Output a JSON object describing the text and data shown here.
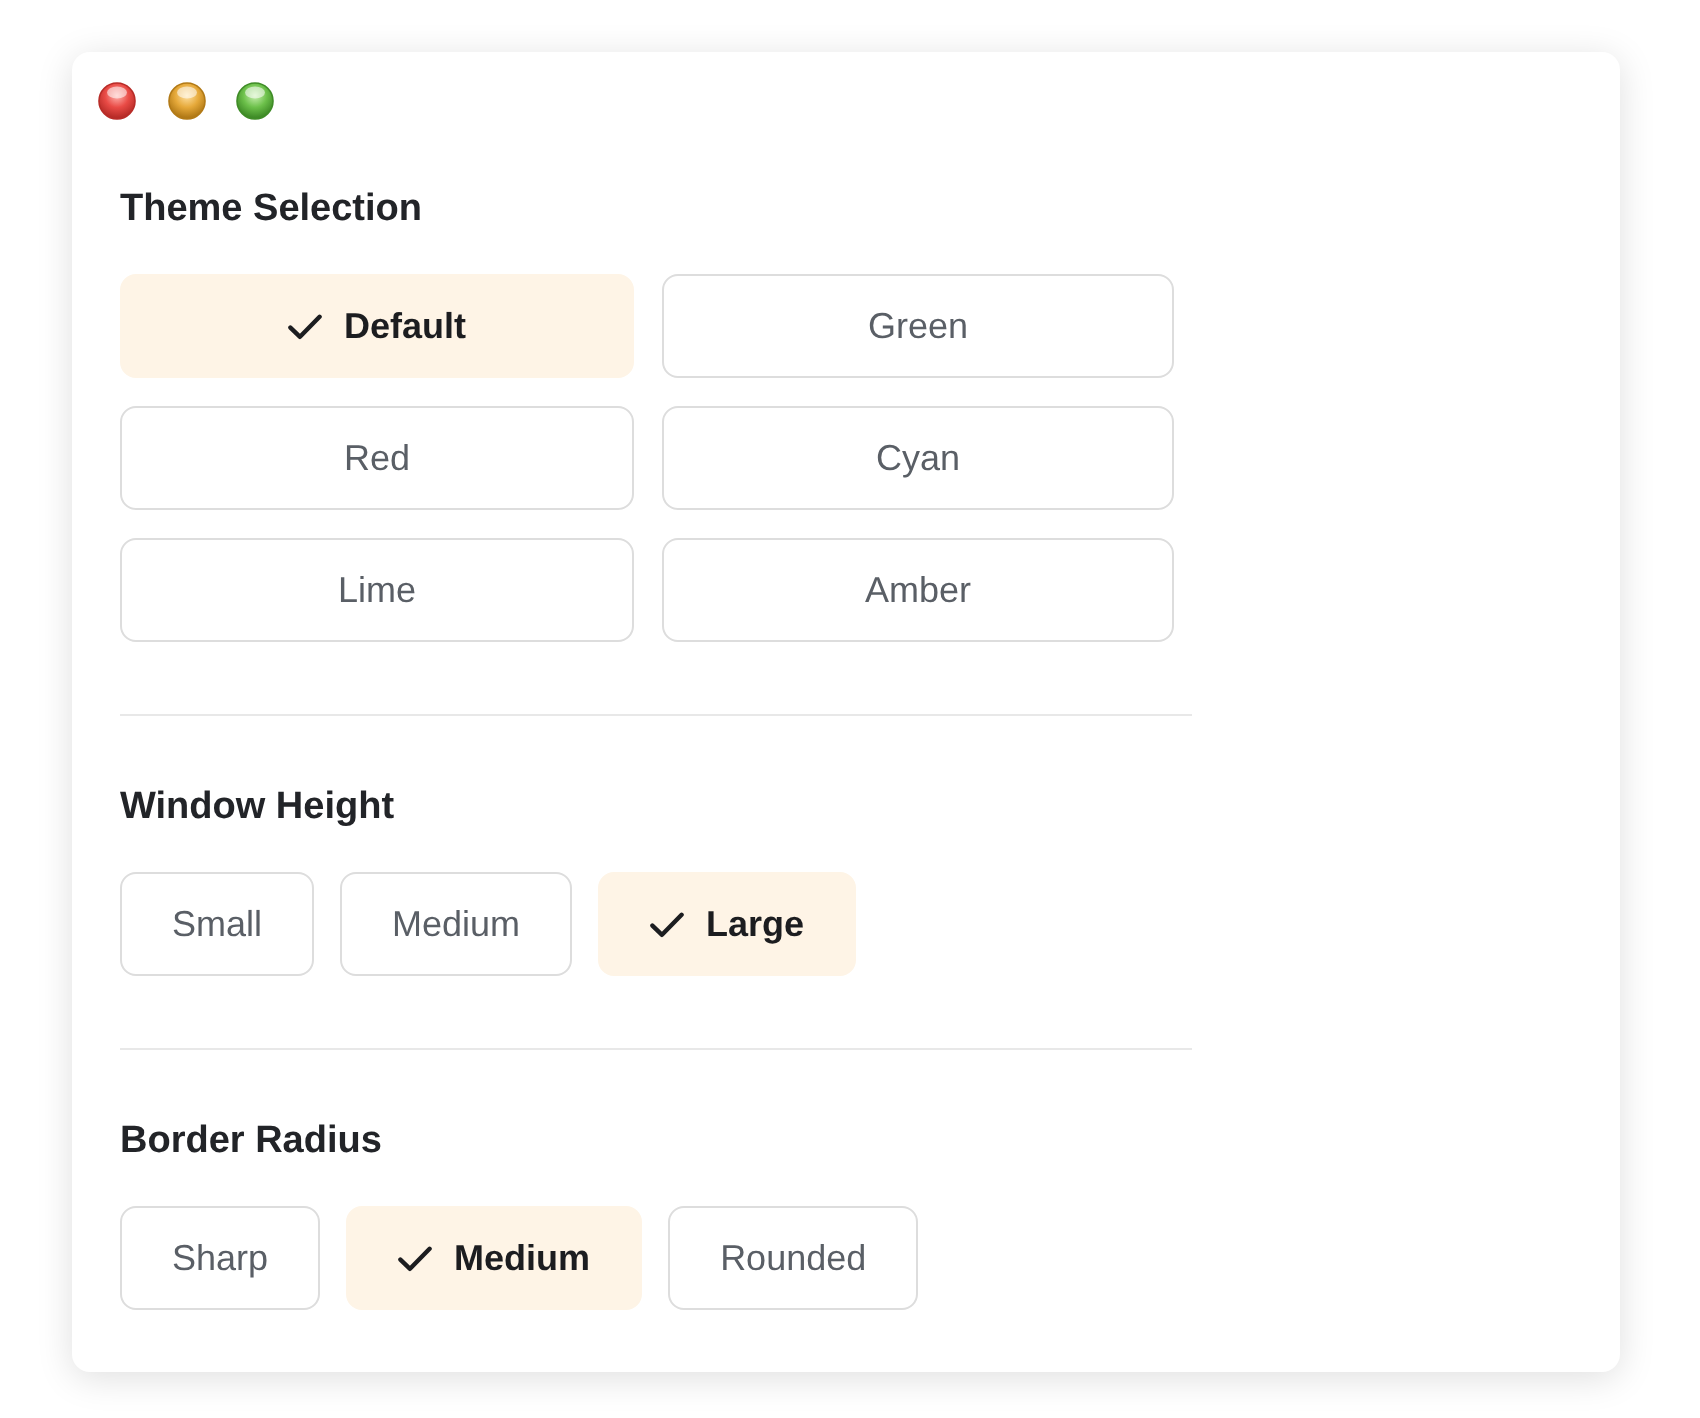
{
  "window": {
    "controls": [
      {
        "kind": "close"
      },
      {
        "kind": "minimize"
      },
      {
        "kind": "zoom"
      }
    ]
  },
  "sections": [
    {
      "title": "Theme Selection",
      "kind": "grid",
      "options": [
        {
          "label": "Default",
          "selected": true
        },
        {
          "label": "Green",
          "selected": false
        },
        {
          "label": "Red",
          "selected": false
        },
        {
          "label": "Cyan",
          "selected": false
        },
        {
          "label": "Lime",
          "selected": false
        },
        {
          "label": "Amber",
          "selected": false
        }
      ]
    },
    {
      "title": "Window Height",
      "kind": "inline",
      "options": [
        {
          "label": "Small",
          "selected": false
        },
        {
          "label": "Medium",
          "selected": false
        },
        {
          "label": "Large",
          "selected": true
        }
      ]
    },
    {
      "title": "Border Radius",
      "kind": "inline",
      "options": [
        {
          "label": "Sharp",
          "selected": false
        },
        {
          "label": "Medium",
          "selected": true
        },
        {
          "label": "Rounded",
          "selected": false
        }
      ]
    }
  ]
}
